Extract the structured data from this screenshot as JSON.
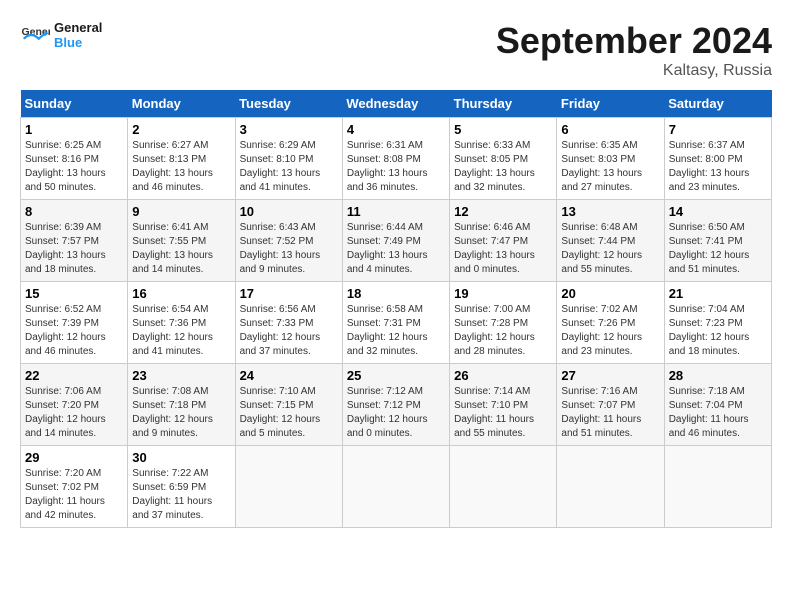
{
  "logo": {
    "text_general": "General",
    "text_blue": "Blue"
  },
  "title": "September 2024",
  "location": "Kaltasy, Russia",
  "days_of_week": [
    "Sunday",
    "Monday",
    "Tuesday",
    "Wednesday",
    "Thursday",
    "Friday",
    "Saturday"
  ],
  "weeks": [
    [
      {
        "day": "1",
        "sunrise": "6:25 AM",
        "sunset": "8:16 PM",
        "daylight": "13 hours and 50 minutes."
      },
      {
        "day": "2",
        "sunrise": "6:27 AM",
        "sunset": "8:13 PM",
        "daylight": "13 hours and 46 minutes."
      },
      {
        "day": "3",
        "sunrise": "6:29 AM",
        "sunset": "8:10 PM",
        "daylight": "13 hours and 41 minutes."
      },
      {
        "day": "4",
        "sunrise": "6:31 AM",
        "sunset": "8:08 PM",
        "daylight": "13 hours and 36 minutes."
      },
      {
        "day": "5",
        "sunrise": "6:33 AM",
        "sunset": "8:05 PM",
        "daylight": "13 hours and 32 minutes."
      },
      {
        "day": "6",
        "sunrise": "6:35 AM",
        "sunset": "8:03 PM",
        "daylight": "13 hours and 27 minutes."
      },
      {
        "day": "7",
        "sunrise": "6:37 AM",
        "sunset": "8:00 PM",
        "daylight": "13 hours and 23 minutes."
      }
    ],
    [
      {
        "day": "8",
        "sunrise": "6:39 AM",
        "sunset": "7:57 PM",
        "daylight": "13 hours and 18 minutes."
      },
      {
        "day": "9",
        "sunrise": "6:41 AM",
        "sunset": "7:55 PM",
        "daylight": "13 hours and 14 minutes."
      },
      {
        "day": "10",
        "sunrise": "6:43 AM",
        "sunset": "7:52 PM",
        "daylight": "13 hours and 9 minutes."
      },
      {
        "day": "11",
        "sunrise": "6:44 AM",
        "sunset": "7:49 PM",
        "daylight": "13 hours and 4 minutes."
      },
      {
        "day": "12",
        "sunrise": "6:46 AM",
        "sunset": "7:47 PM",
        "daylight": "13 hours and 0 minutes."
      },
      {
        "day": "13",
        "sunrise": "6:48 AM",
        "sunset": "7:44 PM",
        "daylight": "12 hours and 55 minutes."
      },
      {
        "day": "14",
        "sunrise": "6:50 AM",
        "sunset": "7:41 PM",
        "daylight": "12 hours and 51 minutes."
      }
    ],
    [
      {
        "day": "15",
        "sunrise": "6:52 AM",
        "sunset": "7:39 PM",
        "daylight": "12 hours and 46 minutes."
      },
      {
        "day": "16",
        "sunrise": "6:54 AM",
        "sunset": "7:36 PM",
        "daylight": "12 hours and 41 minutes."
      },
      {
        "day": "17",
        "sunrise": "6:56 AM",
        "sunset": "7:33 PM",
        "daylight": "12 hours and 37 minutes."
      },
      {
        "day": "18",
        "sunrise": "6:58 AM",
        "sunset": "7:31 PM",
        "daylight": "12 hours and 32 minutes."
      },
      {
        "day": "19",
        "sunrise": "7:00 AM",
        "sunset": "7:28 PM",
        "daylight": "12 hours and 28 minutes."
      },
      {
        "day": "20",
        "sunrise": "7:02 AM",
        "sunset": "7:26 PM",
        "daylight": "12 hours and 23 minutes."
      },
      {
        "day": "21",
        "sunrise": "7:04 AM",
        "sunset": "7:23 PM",
        "daylight": "12 hours and 18 minutes."
      }
    ],
    [
      {
        "day": "22",
        "sunrise": "7:06 AM",
        "sunset": "7:20 PM",
        "daylight": "12 hours and 14 minutes."
      },
      {
        "day": "23",
        "sunrise": "7:08 AM",
        "sunset": "7:18 PM",
        "daylight": "12 hours and 9 minutes."
      },
      {
        "day": "24",
        "sunrise": "7:10 AM",
        "sunset": "7:15 PM",
        "daylight": "12 hours and 5 minutes."
      },
      {
        "day": "25",
        "sunrise": "7:12 AM",
        "sunset": "7:12 PM",
        "daylight": "12 hours and 0 minutes."
      },
      {
        "day": "26",
        "sunrise": "7:14 AM",
        "sunset": "7:10 PM",
        "daylight": "11 hours and 55 minutes."
      },
      {
        "day": "27",
        "sunrise": "7:16 AM",
        "sunset": "7:07 PM",
        "daylight": "11 hours and 51 minutes."
      },
      {
        "day": "28",
        "sunrise": "7:18 AM",
        "sunset": "7:04 PM",
        "daylight": "11 hours and 46 minutes."
      }
    ],
    [
      {
        "day": "29",
        "sunrise": "7:20 AM",
        "sunset": "7:02 PM",
        "daylight": "11 hours and 42 minutes."
      },
      {
        "day": "30",
        "sunrise": "7:22 AM",
        "sunset": "6:59 PM",
        "daylight": "11 hours and 37 minutes."
      },
      null,
      null,
      null,
      null,
      null
    ]
  ]
}
